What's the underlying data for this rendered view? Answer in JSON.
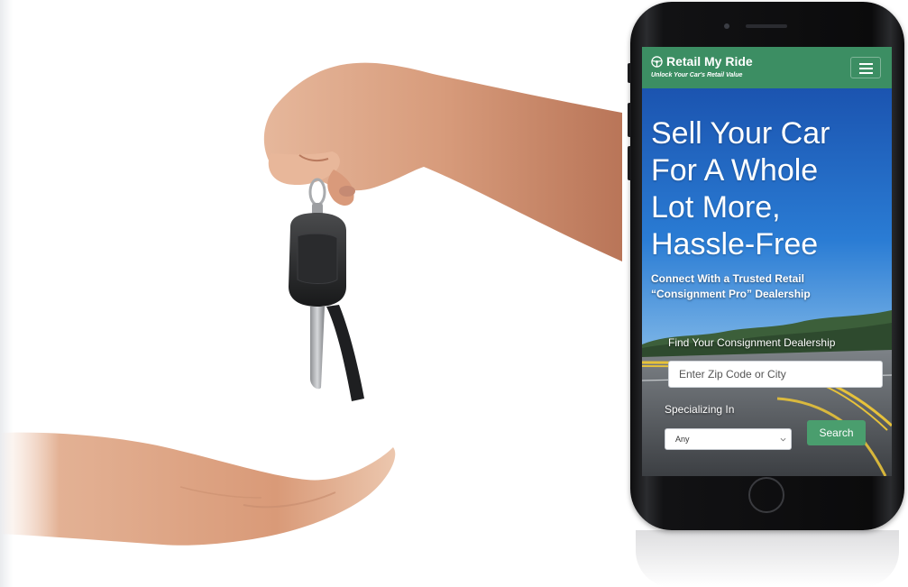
{
  "site": {
    "brand_name": "Retail My Ride",
    "tagline": "Unlock Your Car's Retail Value",
    "logo_icon": "steering-wheel-icon",
    "menu_icon": "hamburger-icon"
  },
  "hero": {
    "title_lines": [
      "Sell Your Car",
      "For A Whole",
      "Lot More,",
      "Hassle-Free"
    ],
    "subtitle_lines": [
      "Connect With a Trusted Retail",
      "“Consignment Pro” Dealership"
    ]
  },
  "search_form": {
    "find_label": "Find Your Consignment Dealership",
    "zip_placeholder": "Enter Zip Code or City",
    "specializing_label": "Specializing In",
    "specializing_value": "Any",
    "search_button": "Search"
  },
  "colors": {
    "brand_green": "#3c8e63",
    "button_green": "#4a9e6e",
    "sky_blue": "#1f5fb0",
    "phone_body": "#0f0f11"
  }
}
